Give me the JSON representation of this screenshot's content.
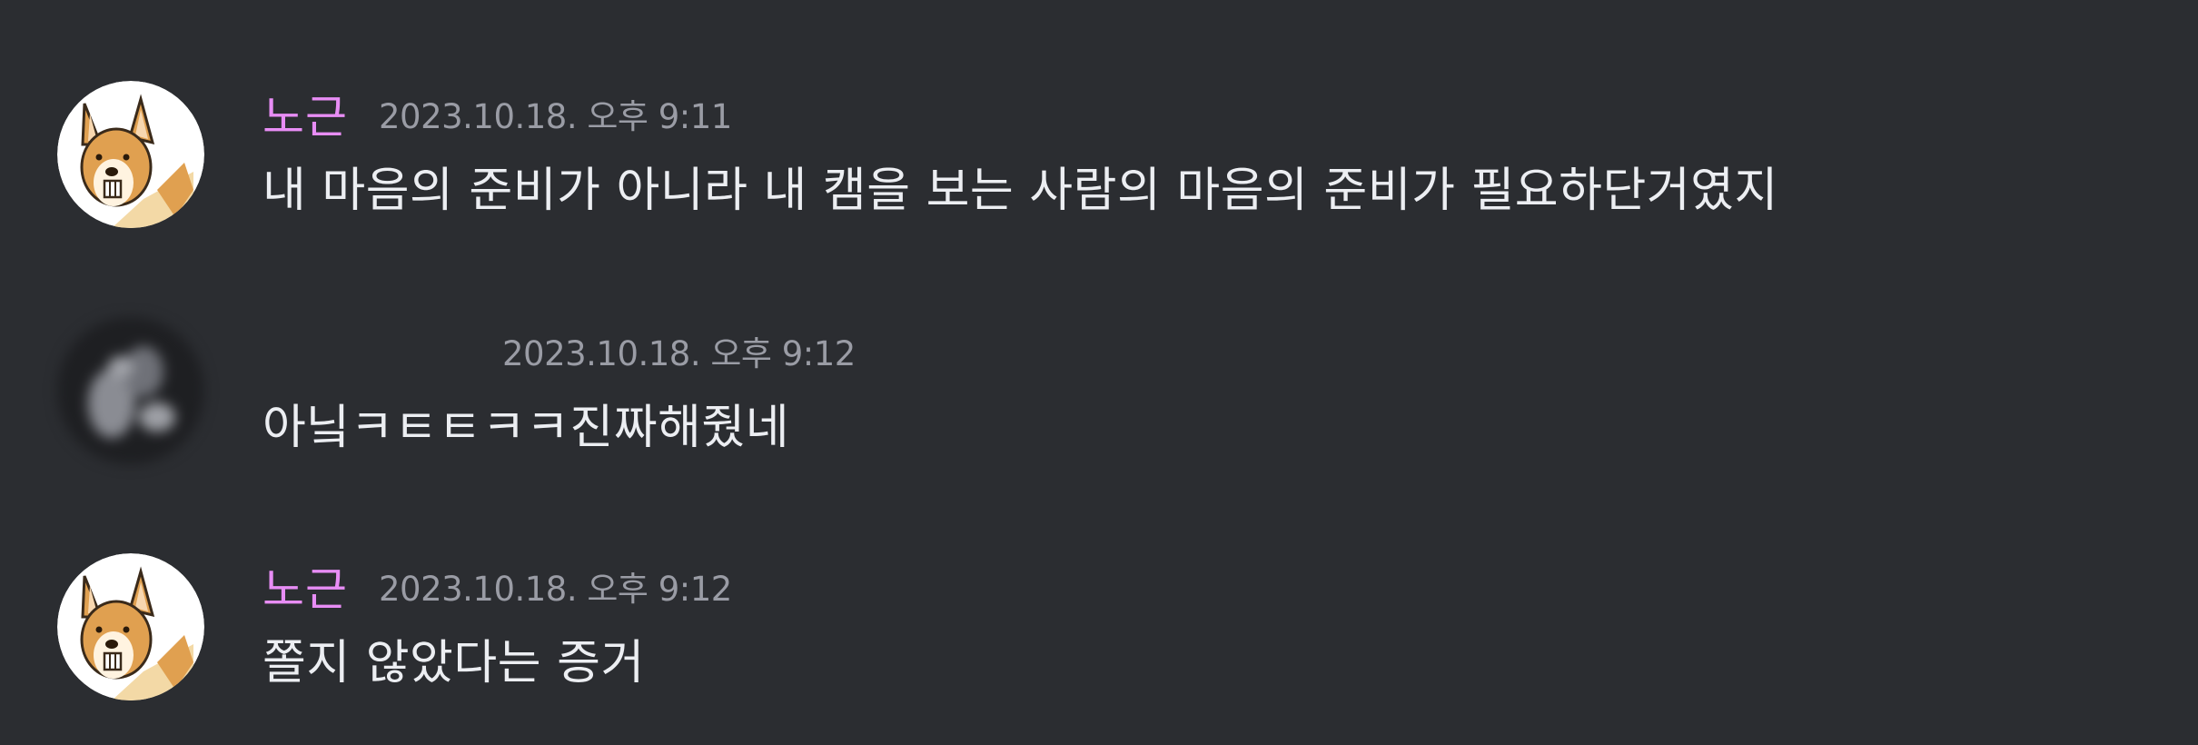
{
  "messages": [
    {
      "username": "노근",
      "timestamp": "2023.10.18. 오후 9:11",
      "text": "내 마음의 준비가 아니라 내 캠을 보는 사람의 마음의 준비가 필요하단거였지",
      "avatar_icon": "corgi-dog-avatar"
    },
    {
      "username": "",
      "timestamp": "2023.10.18. 오후 9:12",
      "text": "아닠ㅋㅌㅌㅋㅋ진짜해줬네",
      "avatar_icon": "blurred-avatar"
    },
    {
      "username": "노근",
      "timestamp": "2023.10.18. 오후 9:12",
      "text": "쫄지 않았다는 증거",
      "avatar_icon": "corgi-dog-avatar"
    }
  ],
  "colors": {
    "background": "#2b2d31",
    "username": "#e88df5",
    "timestamp": "#9a9ca5",
    "text": "#eceef2"
  }
}
